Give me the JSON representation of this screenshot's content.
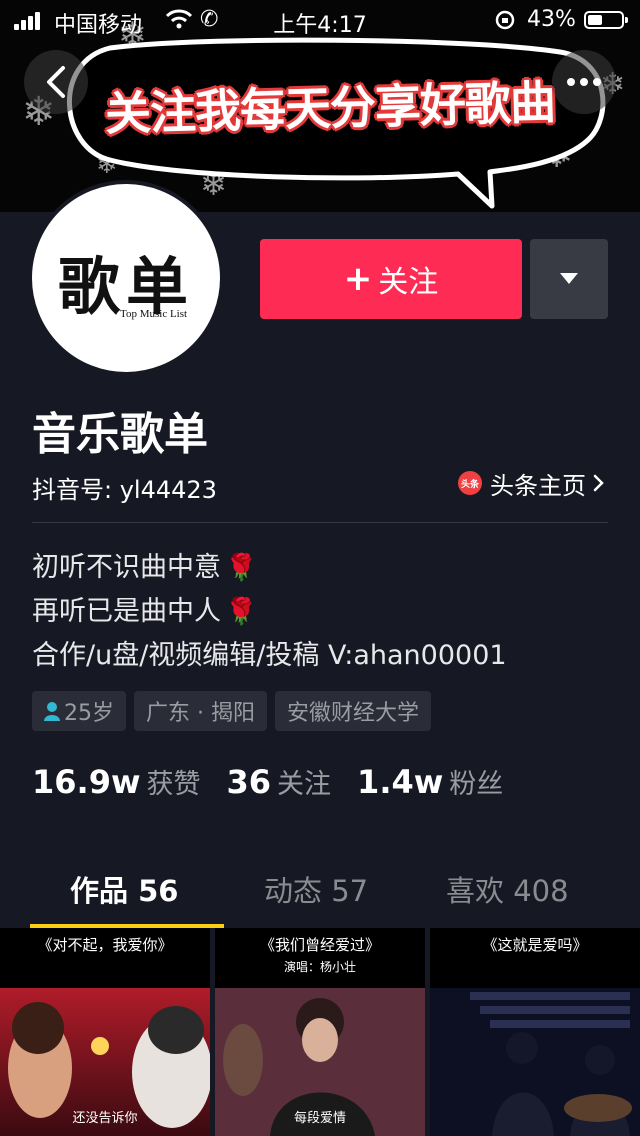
{
  "status_bar": {
    "carrier": "中国移动",
    "time": "上午4:17",
    "battery": "43%",
    "battery_level": 0.43
  },
  "banner": {
    "slogan": "关注我每天分享好歌曲"
  },
  "avatar": {
    "title": "歌单",
    "subtitle": "Top Music List"
  },
  "actions": {
    "follow_label": "关注"
  },
  "profile": {
    "name": "音乐歌单",
    "douyin_id": "抖音号: yl44423",
    "toutiao_link": "头条主页",
    "toutiao_icon_text": "头条"
  },
  "bio": {
    "line1": "初听不识曲中意",
    "line2": "再听已是曲中人",
    "line3": "合作/u盘/视频编辑/投稿 V:ahan00001"
  },
  "tags": {
    "age": "25岁",
    "location": "广东 · 揭阳",
    "school": "安徽财经大学"
  },
  "stats": [
    {
      "num": "16.9w",
      "label": "获赞"
    },
    {
      "num": "36",
      "label": "关注"
    },
    {
      "num": "1.4w",
      "label": "粉丝"
    }
  ],
  "tabs": [
    {
      "label": "作品 56",
      "active": true
    },
    {
      "label": "动态 57",
      "active": false
    },
    {
      "label": "喜欢 408",
      "active": false
    }
  ],
  "videos": [
    {
      "title": "《对不起，我爱你》",
      "sub": "",
      "caption": "还没告诉你"
    },
    {
      "title": "《我们曾经爱过》",
      "sub": "演唱：杨小壮",
      "caption": "每段爱情"
    },
    {
      "title": "《这就是爱吗》",
      "sub": "",
      "caption": ""
    }
  ],
  "colors": {
    "accent": "#fe2c55",
    "background": "#161823",
    "tab_indicator": "#face15"
  }
}
